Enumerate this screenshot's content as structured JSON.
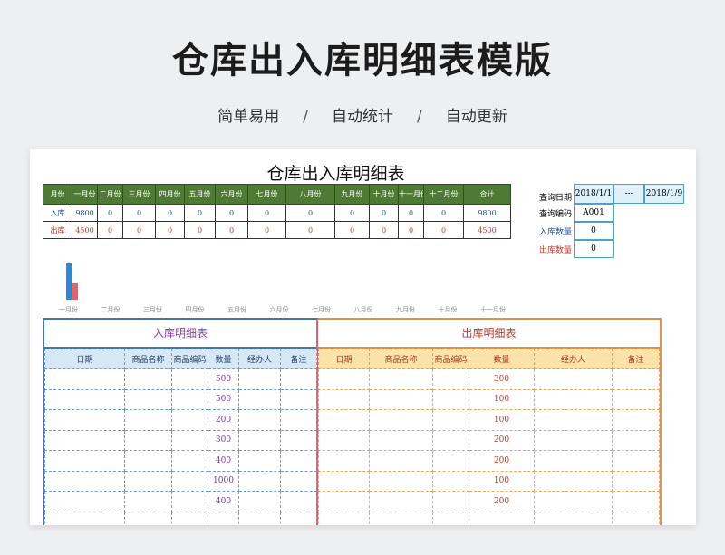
{
  "page": {
    "title": "仓库出入库明细表模版",
    "subtitles": [
      "简单易用",
      "自动统计",
      "自动更新"
    ],
    "separator": "/"
  },
  "sheet": {
    "title": "仓库出入库明细表"
  },
  "summary": {
    "headers": [
      "月份",
      "一月份",
      "二月份",
      "三月份",
      "四月份",
      "五月份",
      "六月份",
      "七月份",
      "八月份",
      "九月份",
      "十月份",
      "十一月份",
      "十二月份",
      "合计"
    ],
    "rows": [
      {
        "label": "入库",
        "values": [
          "9800",
          "0",
          "0",
          "0",
          "0",
          "0",
          "0",
          "0",
          "0",
          "0",
          "0",
          "0",
          "9800"
        ]
      },
      {
        "label": "出库",
        "values": [
          "4500",
          "0",
          "0",
          "0",
          "0",
          "0",
          "0",
          "0",
          "0",
          "0",
          "0",
          "0",
          "4500"
        ]
      }
    ]
  },
  "query": {
    "date_label": "查询日期",
    "date_from": "2018/1/1",
    "date_sep": "---",
    "date_to": "2018/1/9",
    "code_label": "查询编码",
    "code_value": "A001",
    "in_qty_label": "入库数量",
    "in_qty_value": "0",
    "out_qty_label": "出库数量",
    "out_qty_value": "0"
  },
  "chart_data": {
    "type": "bar",
    "categories": [
      "一月份",
      "二月份",
      "三月份",
      "四月份",
      "五月份",
      "六月份",
      "七月份",
      "八月份",
      "九月份",
      "十月份",
      "十一月份"
    ],
    "series": [
      {
        "values": [
          9800,
          0,
          0,
          0,
          0,
          0,
          0,
          0,
          0,
          0,
          0
        ],
        "color": "#2e86de"
      },
      {
        "values": [
          4500,
          0,
          0,
          0,
          0,
          0,
          0,
          0,
          0,
          0,
          0
        ],
        "color": "#e8606a"
      }
    ],
    "ylim": [
      0,
      9800
    ]
  },
  "in_ledger": {
    "title": "入库明细表",
    "headers": [
      "日期",
      "商品名称",
      "商品编码",
      "数量",
      "经办人",
      "备注"
    ],
    "quantities": [
      "500",
      "500",
      "200",
      "300",
      "400",
      "1000",
      "400"
    ]
  },
  "out_ledger": {
    "title": "出库明细表",
    "headers": [
      "日期",
      "商品名称",
      "商品编码",
      "数量",
      "经办人",
      "备注"
    ],
    "quantities": [
      "300",
      "100",
      "100",
      "200",
      "200",
      "100",
      "200"
    ]
  },
  "colors": {
    "summary_header": "#4f7a35",
    "in_accent": "#3c78b4",
    "out_accent": "#e89040"
  }
}
